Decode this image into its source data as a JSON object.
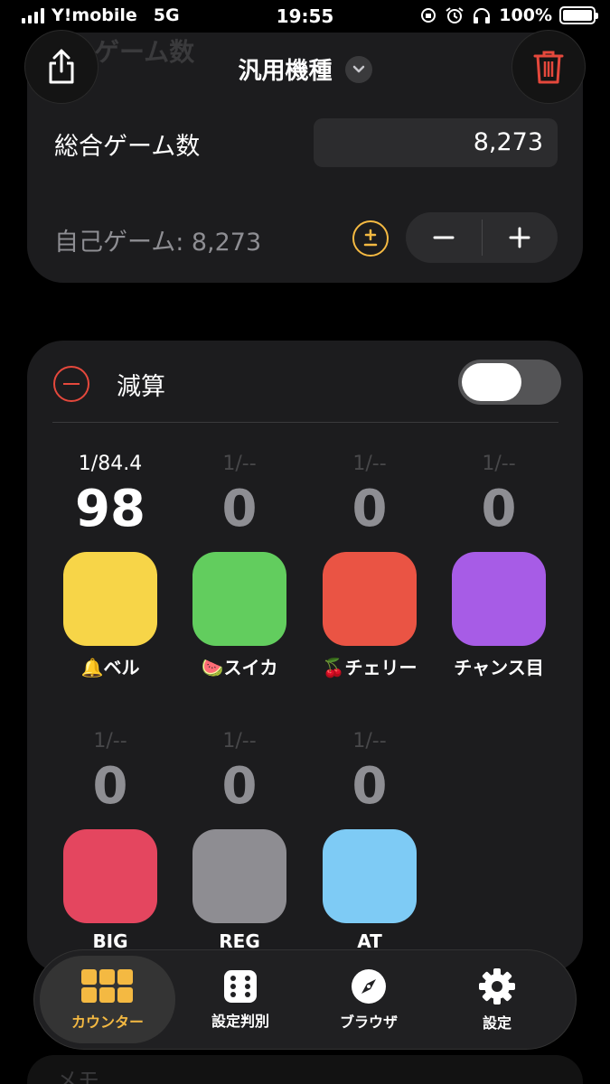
{
  "status_bar": {
    "carrier": "Y!mobile",
    "network": "5G",
    "time": "19:55",
    "battery": "100%"
  },
  "header": {
    "title": "汎用機種",
    "ghost_title": "ゲーム数",
    "share_icon": "share-icon",
    "trash_icon": "trash-icon",
    "accent_red": "#e5483c"
  },
  "games": {
    "total_label": "総合ゲーム数",
    "total_value": "8,273",
    "self_label": "自己ゲーム: 8,273",
    "plus_minus_icon": "plus-minus-icon",
    "minus": "−",
    "plus": "+",
    "accent_yellow": "#f4b942"
  },
  "counter_panel": {
    "subtract_label": "減算",
    "subtract_enabled": false,
    "counters": [
      {
        "prob": "1/84.4",
        "count": "98",
        "label": "🔔ベル",
        "color": "#f7d548"
      },
      {
        "prob": "1/--",
        "count": "0",
        "label": "🍉スイカ",
        "color": "#62cd5e"
      },
      {
        "prob": "1/--",
        "count": "0",
        "label": "🍒チェリー",
        "color": "#ea5444"
      },
      {
        "prob": "1/--",
        "count": "0",
        "label": "チャンス目",
        "color": "#a75ce6"
      },
      {
        "prob": "1/--",
        "count": "0",
        "label": "BIG",
        "color": "#e4465f"
      },
      {
        "prob": "1/--",
        "count": "0",
        "label": "REG",
        "color": "#8e8d92"
      },
      {
        "prob": "1/--",
        "count": "0",
        "label": "AT",
        "color": "#7ecbf5"
      }
    ]
  },
  "tab_bar": {
    "tabs": [
      {
        "label": "カウンター",
        "icon": "grid-icon",
        "active": true
      },
      {
        "label": "設定判別",
        "icon": "dice-icon",
        "active": false
      },
      {
        "label": "ブラウザ",
        "icon": "compass-icon",
        "active": false
      },
      {
        "label": "設定",
        "icon": "gear-icon",
        "active": false
      }
    ]
  },
  "footer": {
    "memo_label": "メモ"
  }
}
